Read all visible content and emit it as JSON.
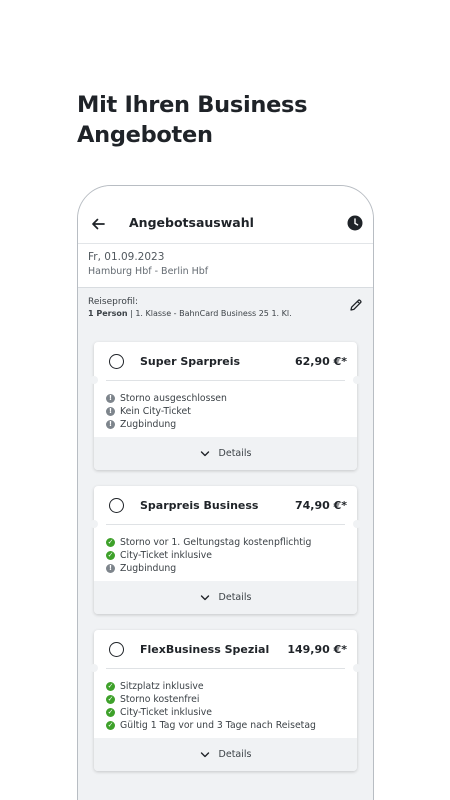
{
  "headline": {
    "line1": "Mit Ihren Business",
    "line2": "Angeboten"
  },
  "appbar": {
    "title": "Angebotsauswahl"
  },
  "journey": {
    "date": "Fr, 01.09.2023",
    "route": "Hamburg Hbf - Berlin Hbf"
  },
  "profile": {
    "label": "Reiseprofil:",
    "persons": "1 Person",
    "details": " | 1. Klasse - BahnCard Business 25 1. Kl."
  },
  "offers": [
    {
      "name": "Super Sparpreis",
      "price": "62,90 €*",
      "features": [
        {
          "text": "Storno ausgeschlossen",
          "status": "neutral"
        },
        {
          "text": "Kein City-Ticket",
          "status": "neutral"
        },
        {
          "text": "Zugbindung",
          "status": "neutral"
        }
      ],
      "details_label": "Details"
    },
    {
      "name": "Sparpreis Business",
      "price": "74,90 €*",
      "features": [
        {
          "text": "Storno vor 1. Geltungstag kostenpflichtig",
          "status": "ok"
        },
        {
          "text": "City-Ticket inklusive",
          "status": "ok"
        },
        {
          "text": "Zugbindung",
          "status": "neutral"
        }
      ],
      "details_label": "Details"
    },
    {
      "name": "FlexBusiness Spezial",
      "price": "149,90 €*",
      "features": [
        {
          "text": "Sitzplatz inklusive",
          "status": "ok"
        },
        {
          "text": "Storno kostenfrei",
          "status": "ok"
        },
        {
          "text": "City-Ticket inklusive",
          "status": "ok"
        },
        {
          "text": "Gültig 1 Tag vor und 3 Tage nach Reisetag",
          "status": "ok"
        }
      ],
      "details_label": "Details"
    }
  ],
  "colors": {
    "ok": "#3ea12a",
    "neutral": "#7e858c",
    "text": "#1f2328",
    "background": "#f0f2f4"
  },
  "icons": {
    "back": "arrow-left-icon",
    "history": "clock-icon",
    "edit": "pencil-icon",
    "expand": "chevron-down-icon",
    "ok": "check-circle-icon",
    "neutral": "info-circle-icon"
  }
}
